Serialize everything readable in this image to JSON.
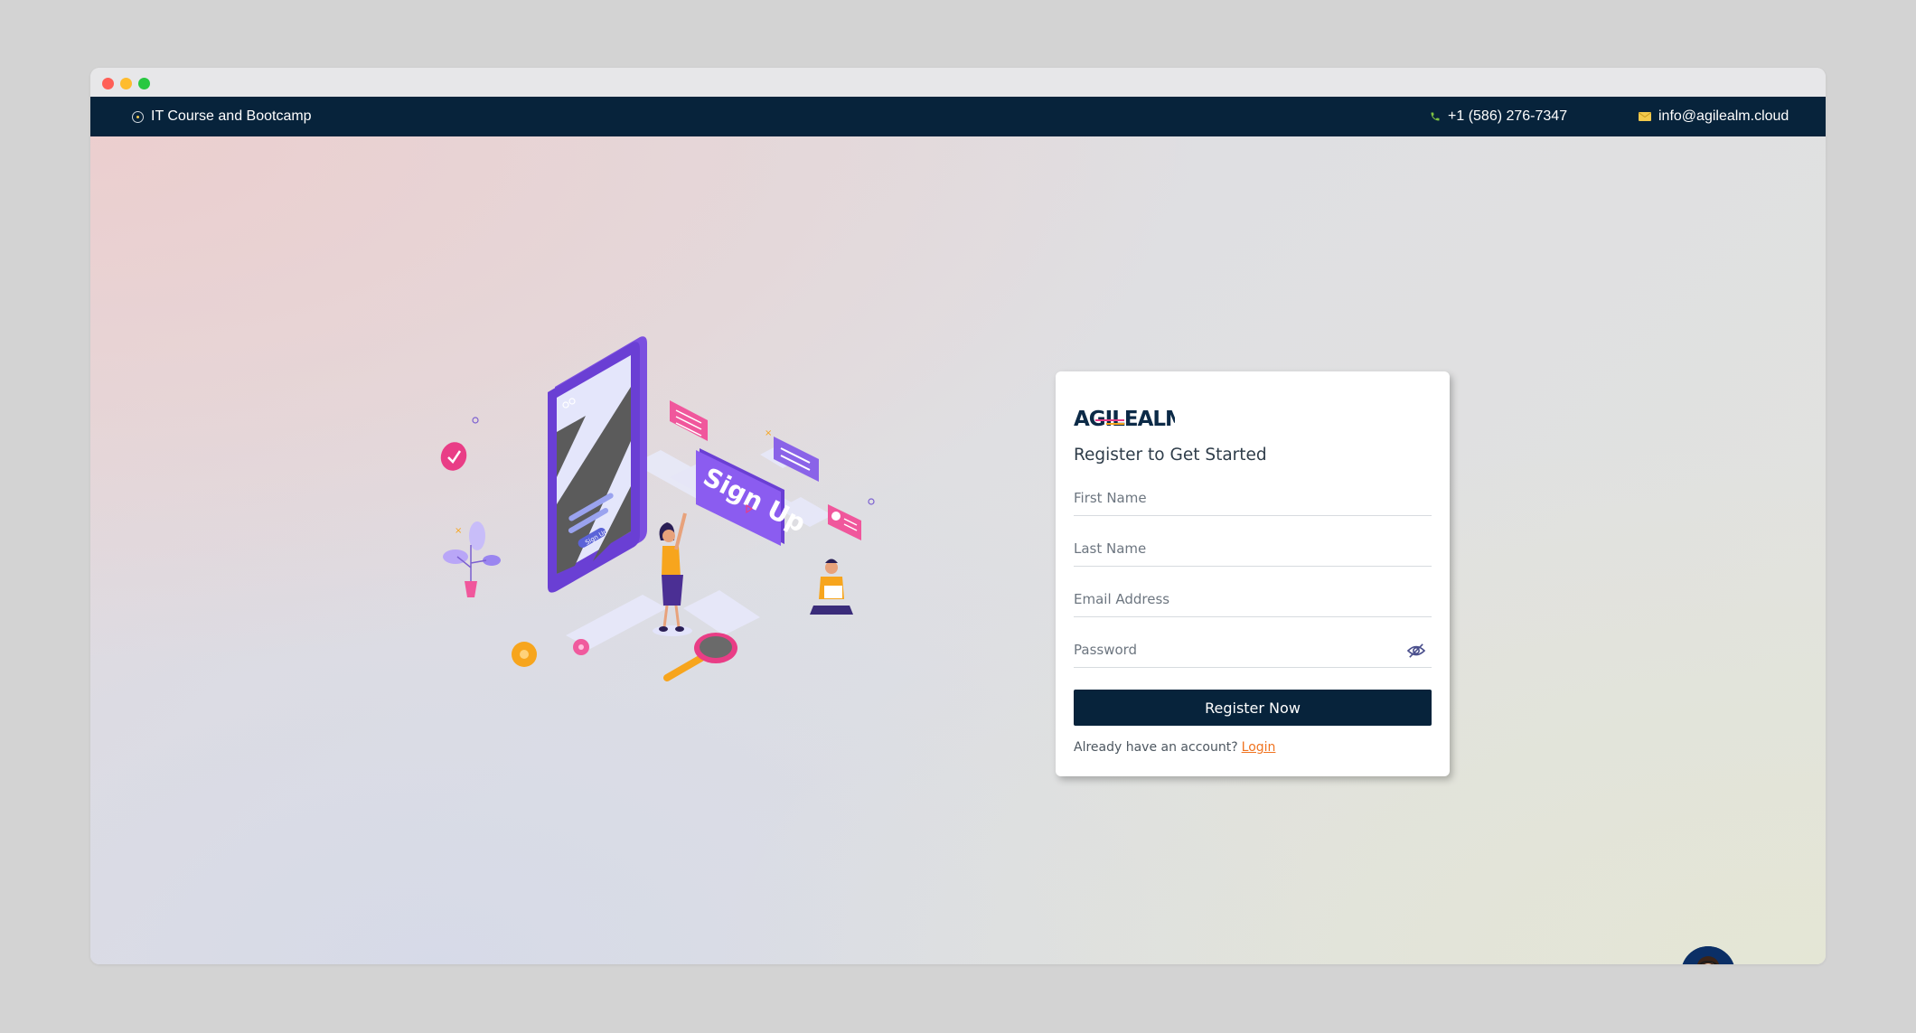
{
  "browser": {
    "controls": [
      "close",
      "minimize",
      "maximize"
    ]
  },
  "topbar": {
    "tagline": "IT Course and Bootcamp",
    "phone": "+1 (586) 276-7347",
    "email": "info@agilealm.cloud",
    "icons": {
      "tagline": "circle-dot-icon",
      "phone": "phone-icon",
      "email": "envelope-icon"
    },
    "colors": {
      "background": "#07233b",
      "phone_icon": "#7ec242",
      "email_icon": "#f2c94c"
    }
  },
  "illustration": {
    "sign_text": "Sign Up",
    "phone_button_text": "Sign Up"
  },
  "register_card": {
    "logo_text": "AGILEALM",
    "heading": "Register to Get Started",
    "fields": {
      "first_name": {
        "placeholder": "First Name",
        "value": ""
      },
      "last_name": {
        "placeholder": "Last Name",
        "value": ""
      },
      "email": {
        "placeholder": "Email Address",
        "value": ""
      },
      "password": {
        "placeholder": "Password",
        "value": "",
        "toggle_icon": "eye-slash-icon"
      }
    },
    "submit_label": "Register Now",
    "account_prompt": "Already have an account?",
    "login_link": "Login",
    "colors": {
      "button": "#07233b",
      "link": "#f0731f"
    }
  },
  "chat_widget": {
    "icon": "support-agent-avatar"
  }
}
